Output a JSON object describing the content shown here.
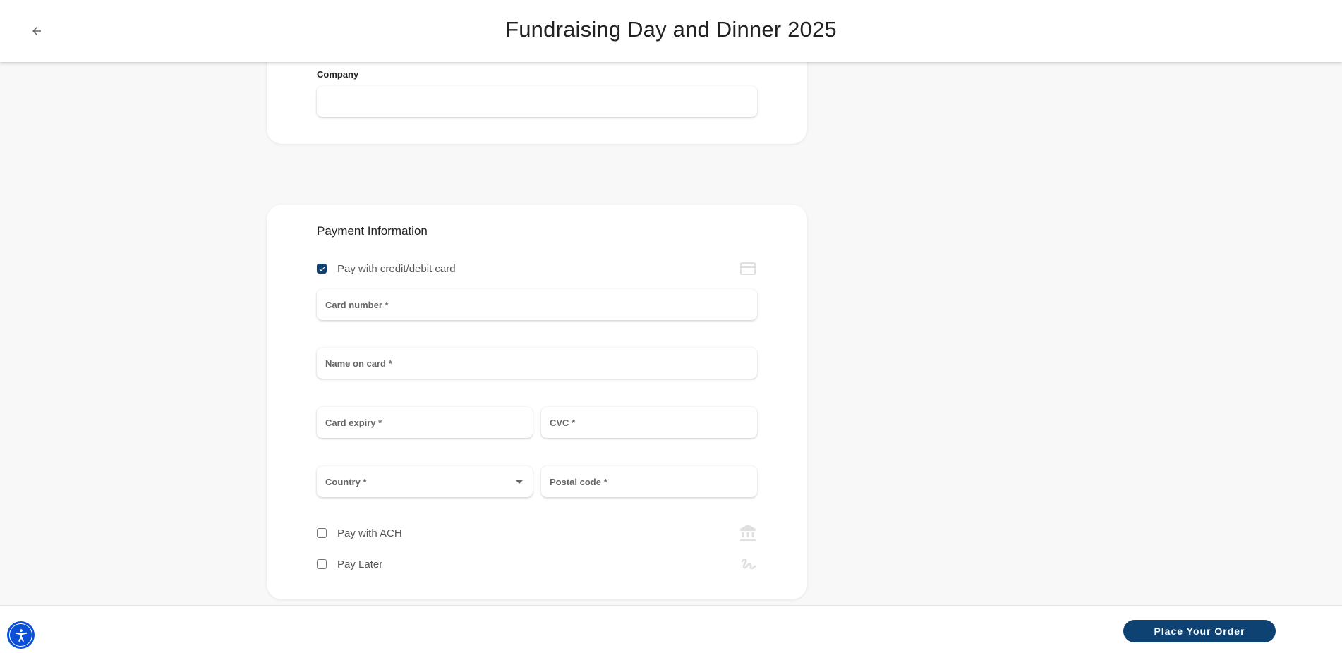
{
  "header": {
    "title": "Fundraising Day and Dinner 2025",
    "back_icon": "arrow-left-icon"
  },
  "company_section": {
    "label": "Company",
    "value": "",
    "placeholder": ""
  },
  "payment": {
    "title": "Payment Information",
    "options": [
      {
        "label": "Pay with credit/debit card",
        "checked": true,
        "icon": "credit-card-icon"
      },
      {
        "label": "Pay with ACH",
        "checked": false,
        "icon": "bank-icon"
      },
      {
        "label": "Pay Later",
        "checked": false,
        "icon": "signature-icon"
      }
    ],
    "fields": {
      "card_number": {
        "placeholder": "Card number *",
        "value": ""
      },
      "name_on_card": {
        "placeholder": "Name on card *",
        "value": ""
      },
      "card_expiry": {
        "placeholder": "Card expiry *",
        "value": ""
      },
      "cvc": {
        "placeholder": "CVC *",
        "value": ""
      },
      "country": {
        "placeholder": "Country *",
        "value": ""
      },
      "postal_code": {
        "placeholder": "Postal code *",
        "value": ""
      }
    }
  },
  "footer": {
    "accessibility_icon": "accessibility-icon",
    "place_order_label": "Place Your Order"
  },
  "colors": {
    "primary": "#0e4272",
    "accessibility": "#0a4fd6",
    "background": "#f8f8f8"
  }
}
